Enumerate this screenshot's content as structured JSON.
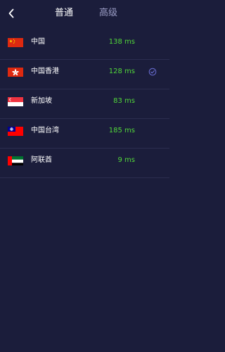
{
  "header": {
    "back_icon": "chevron-left-icon",
    "tabs": [
      {
        "label": "普通",
        "active": true
      },
      {
        "label": "高级",
        "active": false
      }
    ]
  },
  "colors": {
    "background": "#1b1d3b",
    "latency": "#52d83a",
    "inactive_tab": "#9a9cc4",
    "check": "#6b6fd6"
  },
  "servers": [
    {
      "name": "中国",
      "latency": "138 ms",
      "flag": "china-flag-icon",
      "selected": false
    },
    {
      "name": "中国香港",
      "latency": "128 ms",
      "flag": "hong-kong-flag-icon",
      "selected": true
    },
    {
      "name": "新加坡",
      "latency": "83 ms",
      "flag": "singapore-flag-icon",
      "selected": false
    },
    {
      "name": "中国台湾",
      "latency": "185 ms",
      "flag": "taiwan-flag-icon",
      "selected": false
    },
    {
      "name": "阿联酋",
      "latency": "9 ms",
      "flag": "uae-flag-icon",
      "selected": false
    }
  ]
}
